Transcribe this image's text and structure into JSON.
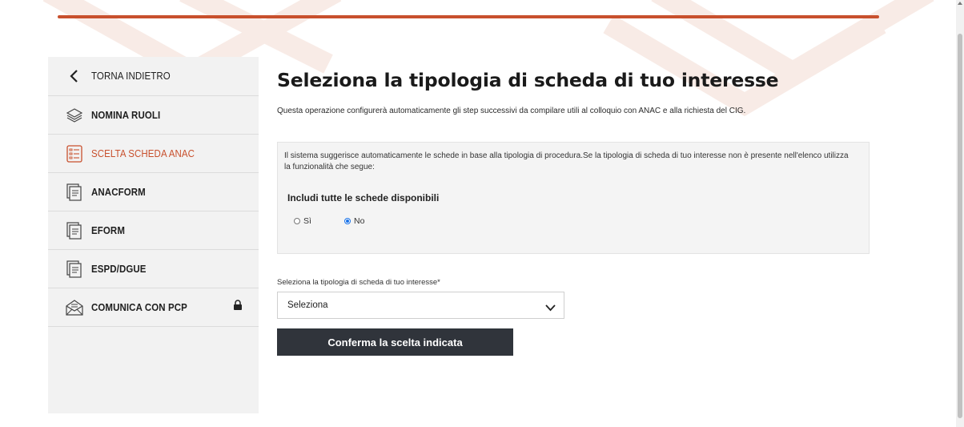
{
  "sidebar": {
    "items": [
      {
        "label": "TORNA INDIETRO",
        "icon": "chevron-left-icon",
        "active": false
      },
      {
        "label": "NOMINA RUOLI",
        "icon": "layers-icon",
        "active": false
      },
      {
        "label": "SCELTA SCHEDA ANAC",
        "icon": "checklist-icon",
        "active": true
      },
      {
        "label": "ANACFORM",
        "icon": "documents-icon",
        "active": false
      },
      {
        "label": "EFORM",
        "icon": "documents-icon",
        "active": false
      },
      {
        "label": "ESPD/DGUE",
        "icon": "documents-icon",
        "active": false
      },
      {
        "label": "COMUNICA CON PCP",
        "icon": "envelope-open-icon",
        "active": false,
        "locked": true
      }
    ]
  },
  "main": {
    "title": "Seleziona la tipologia di scheda di tuo interesse",
    "subtitle": "Questa operazione configurerà automaticamente gli step successivi da compilare utili al colloquio con ANAC e alla richiesta del CIG.",
    "info_text": "Il sistema suggerisce automaticamente le schede in base alla tipologia di procedura.Se la tipologia di scheda di tuo interesse non è presente nell'elenco utilizza la funzionalità che segue:",
    "include_label": "Includi tutte le schede disponibili",
    "radio_options": [
      {
        "label": "Sì",
        "checked": false
      },
      {
        "label": "No",
        "checked": true
      }
    ],
    "select_label": "Seleziona la tipologia di scheda di tuo interesse*",
    "select_value": "Seleziona",
    "confirm_label": "Conferma la scelta indicata"
  },
  "colors": {
    "accent": "#c8502d",
    "button_bg": "#30343b",
    "sidebar_bg": "#f2f2f2",
    "radio_selected": "#1a73e8"
  }
}
